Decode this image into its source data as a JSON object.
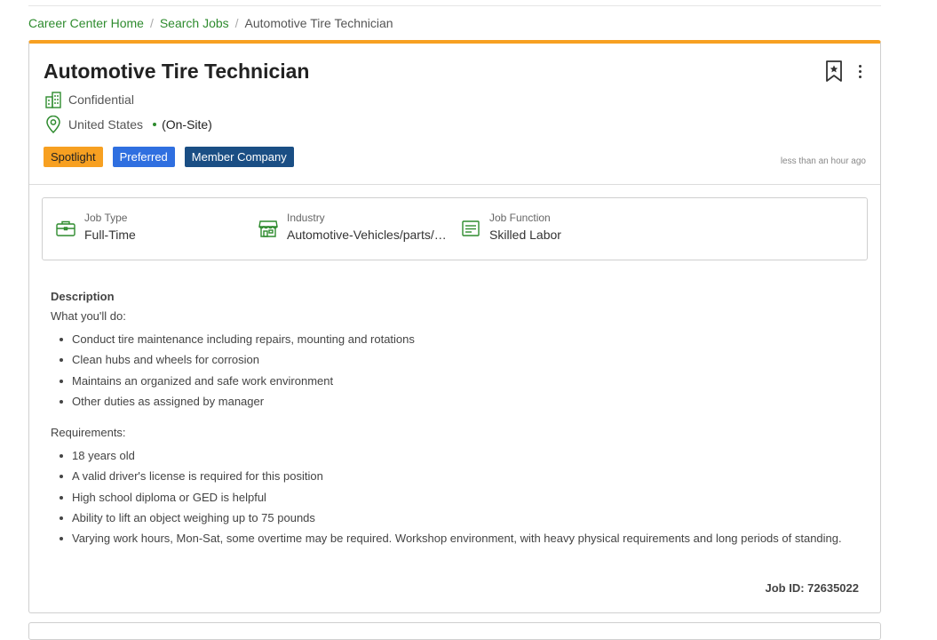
{
  "breadcrumb": {
    "home": "Career Center Home",
    "search": "Search Jobs",
    "current": "Automotive Tire Technician"
  },
  "job": {
    "title": "Automotive Tire Technician",
    "company": "Confidential",
    "location": "United States",
    "workplace": "(On-Site)",
    "posted": "less than an hour ago",
    "badges": {
      "spotlight": "Spotlight",
      "preferred": "Preferred",
      "member": "Member Company"
    },
    "facts": {
      "job_type_label": "Job Type",
      "job_type_value": "Full-Time",
      "industry_label": "Industry",
      "industry_value": "Automotive-Vehicles/parts/…",
      "function_label": "Job Function",
      "function_value": "Skilled Labor"
    },
    "description": {
      "heading": "Description",
      "duties_intro": "What you'll do:",
      "duties": [
        "Conduct tire maintenance including repairs, mounting and rotations",
        "Clean hubs and wheels for corrosion",
        "Maintains an organized and safe work environment",
        "Other duties as assigned by manager"
      ],
      "requirements_intro": "Requirements:",
      "requirements": [
        "18 years old",
        "A valid driver's license is required for this position",
        "High school diploma or GED is helpful",
        "Ability to lift an object weighing up to 75 pounds",
        "Varying work hours, Mon-Sat, some overtime may be required. Workshop environment, with heavy physical requirements and long periods of standing."
      ]
    },
    "job_id": "Job ID: 72635022"
  },
  "colors": {
    "accent_green": "#2e8b2e",
    "spotlight": "#f7a021",
    "preferred": "#2f6fe0",
    "member": "#1a4e84"
  },
  "icons": {
    "company": "building-icon",
    "location": "map-pin-icon",
    "job_type": "briefcase-icon",
    "industry": "storefront-icon",
    "function": "document-list-icon",
    "save": "bookmark-star-icon",
    "more": "kebab-menu-icon"
  }
}
